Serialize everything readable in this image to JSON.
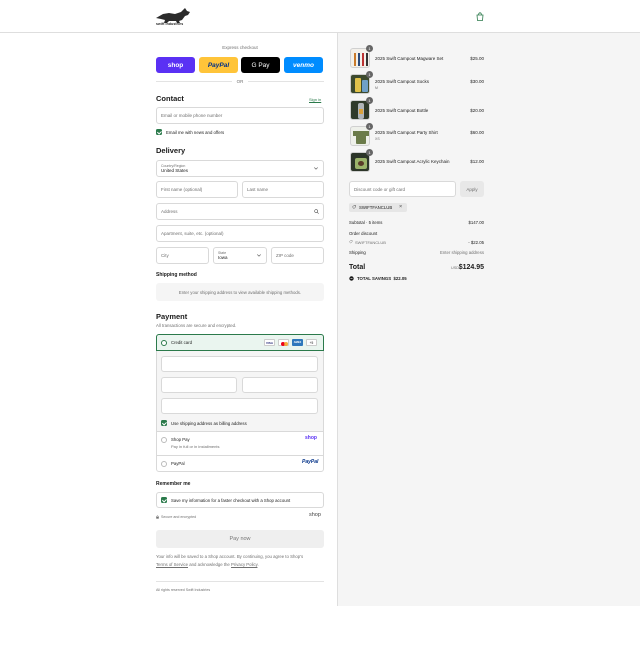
{
  "brand": {
    "name": "swift industries"
  },
  "express": {
    "title": "Express checkout",
    "or": "OR",
    "buttons": [
      {
        "label": "shop",
        "bg": "#5a31f4",
        "fg": "#ffffff"
      },
      {
        "label": "PayPal",
        "bg": "#ffc439",
        "fg": "#003087"
      },
      {
        "label": "G Pay",
        "bg": "#000000",
        "fg": "#ffffff"
      },
      {
        "label": "venmo",
        "bg": "#008cff",
        "fg": "#ffffff"
      }
    ]
  },
  "contact": {
    "title": "Contact",
    "sign_in": "Sign in",
    "email_placeholder": "Email or mobile phone number",
    "newsletter_label": "Email me with news and offers"
  },
  "delivery": {
    "title": "Delivery",
    "country_label": "Country/Region",
    "country_value": "United States",
    "first_name": "First name (optional)",
    "last_name": "Last name",
    "address": "Address",
    "apartment": "Apartment, suite, etc. (optional)",
    "city": "City",
    "state_label": "State",
    "state_value": "Iowa",
    "zip": "ZIP code"
  },
  "shipping_method": {
    "title": "Shipping method",
    "message": "Enter your shipping address to view available shipping methods."
  },
  "payment": {
    "title": "Payment",
    "subtitle": "All transactions are secure and encrypted.",
    "credit_card_label": "Credit card",
    "card_brands": [
      "VISA",
      "MC",
      "AMEX",
      "+5"
    ],
    "billing_label": "Use shipping address as billing address",
    "shop_pay_label": "Shop Pay",
    "shop_pay_sub": "Pay in full or in installments",
    "shop_pay_logo": "shop",
    "paypal_label": "PayPal",
    "paypal_logo": "PayPal"
  },
  "remember": {
    "title": "Remember me",
    "save_label": "Save my information for a faster checkout with a Shop account",
    "secure_label": "Secure and encrypted",
    "shop_logo": "shop"
  },
  "pay_now": "Pay now",
  "legal": {
    "text_1": "Your info will be saved to a Shop account. By continuing, you agree to Shop's",
    "terms": "Terms of Service",
    "text_2": "and acknowledge the",
    "privacy": "Privacy Policy",
    "end": "."
  },
  "footer": "All rights reserved Swift Industries",
  "cart": {
    "items": [
      {
        "qty": "1",
        "name": "2025 Swift Campout Magware Set",
        "sub": "",
        "price": "$25.00"
      },
      {
        "qty": "1",
        "name": "2025 Swift Campout Socks",
        "sub": "M",
        "price": "$30.00"
      },
      {
        "qty": "1",
        "name": "2025 Swift Campout Bottle",
        "sub": "",
        "price": "$20.00"
      },
      {
        "qty": "1",
        "name": "2025 Swift Campout Party Shirt",
        "sub": "XS",
        "price": "$60.00"
      },
      {
        "qty": "1",
        "name": "2025 Swift Campout Acrylic Keychain",
        "sub": "",
        "price": "$12.00"
      }
    ],
    "discount_placeholder": "Discount code or gift card",
    "apply": "Apply",
    "applied_code": "SWIFTFANCLUB",
    "subtotal_label": "Subtotal · 5 items",
    "subtotal_value": "$147.00",
    "order_discount_label": "Order discount",
    "discount_code": "SWIFTFANCLUB",
    "discount_value": "- $22.05",
    "shipping_label": "Shipping",
    "shipping_value": "Enter shipping address",
    "total_label": "Total",
    "currency": "USD",
    "total_value": "$124.95",
    "savings_label": "TOTAL SAVINGS",
    "savings_value": "$22.05"
  }
}
